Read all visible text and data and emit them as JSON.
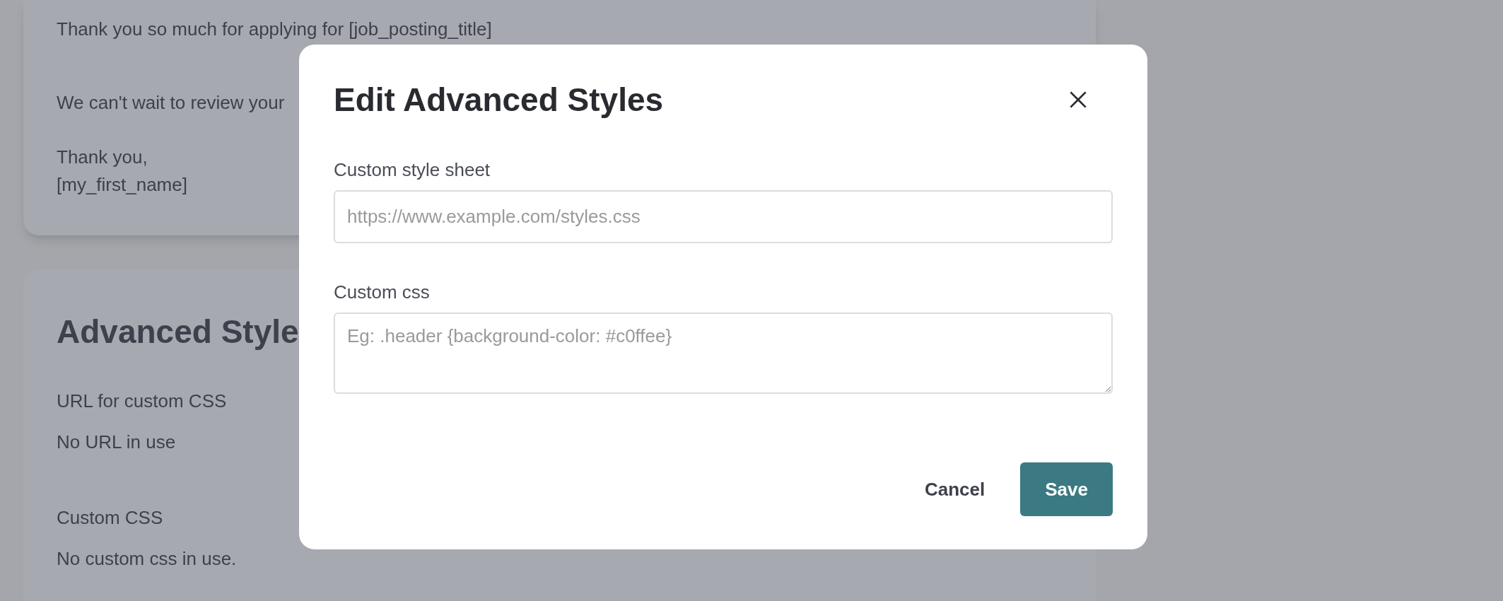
{
  "background": {
    "email_card": {
      "lines": [
        "Thank you so much for applying for [job_posting_title]",
        "We can't wait to review your",
        "Thank you,\n[my_first_name]"
      ]
    },
    "styles_card": {
      "title": "Advanced Style",
      "fields": [
        {
          "label": "URL for custom CSS",
          "value": "No URL in use"
        },
        {
          "label": "Custom CSS",
          "value": "No custom css in use."
        }
      ]
    }
  },
  "dialog": {
    "title": "Edit Advanced Styles",
    "fields": [
      {
        "kind": "input",
        "label": "Custom style sheet",
        "placeholder": "https://www.example.com/styles.css"
      },
      {
        "kind": "textarea",
        "label": "Custom css",
        "placeholder": "Eg: .header {background-color: #c0ffee}"
      }
    ],
    "buttons": [
      {
        "kind": "secondary",
        "label": "Cancel"
      },
      {
        "kind": "primary",
        "label": "Save"
      }
    ]
  }
}
